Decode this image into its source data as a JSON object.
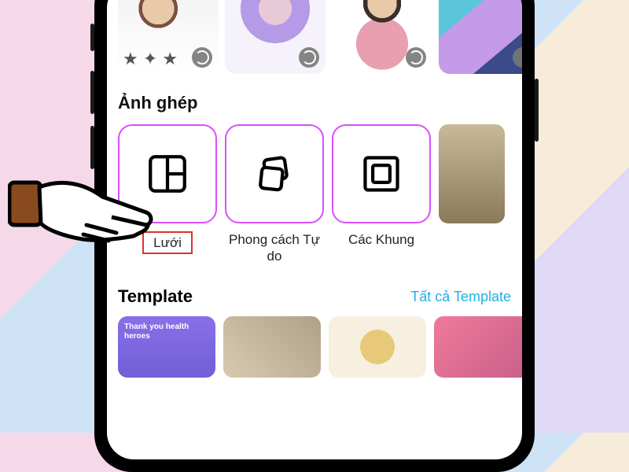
{
  "sections": {
    "collage_title": "Ảnh ghép",
    "template_title": "Template",
    "template_link": "Tất cả Template"
  },
  "collage_options": [
    {
      "id": "grid",
      "label": "Lưới",
      "highlighted": true
    },
    {
      "id": "freestyle",
      "label": "Phong cách Tự do",
      "highlighted": false
    },
    {
      "id": "frames",
      "label": "Các Khung",
      "highlighted": false
    }
  ],
  "templates": [
    {
      "caption": "Thank you health heroes"
    },
    {
      "caption": ""
    },
    {
      "caption": ""
    },
    {
      "caption": ""
    }
  ]
}
